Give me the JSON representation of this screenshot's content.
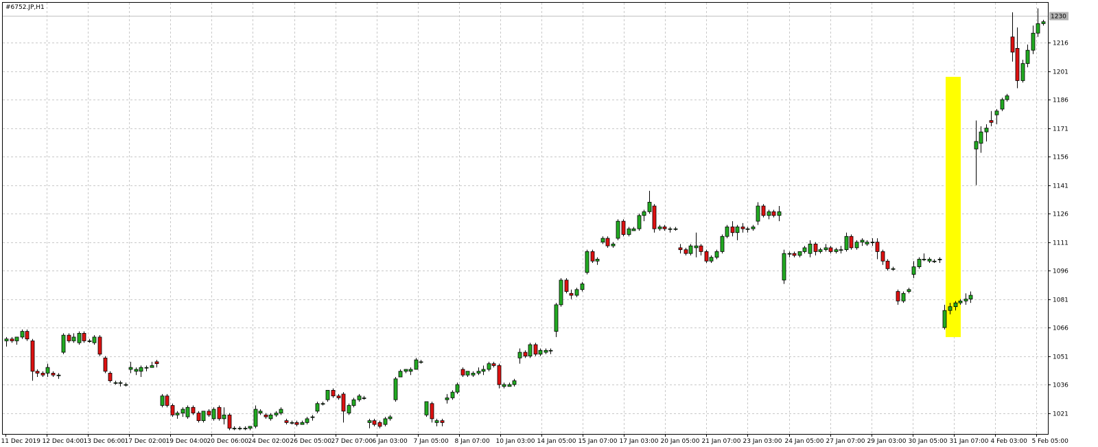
{
  "title": "#6752.JP,H1",
  "chart_data": {
    "type": "candlestick",
    "title": "#6752.JP,H1",
    "ylim": [
      1010,
      1237
    ],
    "y_ticks": [
      1216,
      1201,
      1186,
      1171,
      1156,
      1141,
      1126,
      1111,
      1096,
      1081,
      1066,
      1051,
      1036,
      1021
    ],
    "current_price": 1230,
    "x_ticks": [
      "11 Dec 2019",
      "12 Dec 04:00",
      "13 Dec 06:00",
      "17 Dec 02:00",
      "19 Dec 04:00",
      "20 Dec 06:00",
      "24 Dec 02:00",
      "26 Dec 05:00",
      "27 Dec 07:00",
      "6 Jan 03:00",
      "7 Jan 05:00",
      "8 Jan 07:00",
      "10 Jan 03:00",
      "14 Jan 05:00",
      "15 Jan 07:00",
      "17 Jan 03:00",
      "20 Jan 05:00",
      "21 Jan 07:00",
      "23 Jan 03:00",
      "24 Jan 05:00",
      "27 Jan 07:00",
      "29 Jan 03:00",
      "30 Jan 05:00",
      "31 Jan 07:00",
      "4 Feb 03:00",
      "5 Feb 05:00"
    ],
    "grid": true,
    "up_color": "#22aa22",
    "down_color": "#dd1111",
    "highlight_color": "#ffff00",
    "highlight_range": [
      1061,
      1198
    ],
    "candles": [
      [
        1059,
        1061,
        1056,
        1060
      ],
      [
        1060,
        1061,
        1058,
        1059
      ],
      [
        1059,
        1061,
        1057,
        1061
      ],
      [
        1061,
        1065,
        1060,
        1064
      ],
      [
        1064,
        1065,
        1059,
        1060
      ],
      [
        1059,
        1060,
        1038,
        1043
      ],
      [
        1043,
        1044,
        1040,
        1042
      ],
      [
        1042,
        1043,
        1040,
        1041
      ],
      [
        1042,
        1047,
        1040,
        1045
      ],
      [
        1042,
        1043,
        1040,
        1041
      ],
      [
        1041,
        1042,
        1039,
        1041
      ],
      [
        1053,
        1063,
        1052,
        1062
      ],
      [
        1062,
        1063,
        1058,
        1059
      ],
      [
        1059,
        1063,
        1058,
        1061
      ],
      [
        1058,
        1064,
        1057,
        1063
      ],
      [
        1063,
        1064,
        1058,
        1059
      ],
      [
        1059,
        1060,
        1058,
        1059
      ],
      [
        1058,
        1062,
        1057,
        1061
      ],
      [
        1061,
        1062,
        1051,
        1052
      ],
      [
        1050,
        1051,
        1042,
        1043
      ],
      [
        1042,
        1043,
        1037,
        1038
      ],
      [
        1037,
        1038,
        1036,
        1037
      ],
      [
        1037,
        1038,
        1035,
        1037
      ],
      [
        1036,
        1037,
        1035,
        1036
      ],
      [
        1044,
        1048,
        1042,
        1045
      ],
      [
        1043,
        1045,
        1041,
        1044
      ],
      [
        1043,
        1046,
        1040,
        1045
      ],
      [
        1045,
        1046,
        1043,
        1045
      ],
      [
        1045,
        1048,
        1045,
        1046
      ],
      [
        1048,
        1049,
        1045,
        1047
      ],
      [
        1025,
        1031,
        1024,
        1030
      ],
      [
        1030,
        1031,
        1024,
        1025
      ],
      [
        1025,
        1026,
        1019,
        1020
      ],
      [
        1020,
        1022,
        1018,
        1021
      ],
      [
        1021,
        1024,
        1019,
        1023
      ],
      [
        1019,
        1025,
        1018,
        1024
      ],
      [
        1024,
        1025,
        1020,
        1021
      ],
      [
        1021,
        1022,
        1016,
        1017
      ],
      [
        1017,
        1022,
        1016,
        1022
      ],
      [
        1022,
        1023,
        1019,
        1020
      ],
      [
        1018,
        1024,
        1017,
        1023
      ],
      [
        1024,
        1025,
        1017,
        1018
      ],
      [
        1018,
        1024,
        1015,
        1020
      ],
      [
        1020,
        1021,
        1012,
        1013
      ],
      [
        1013,
        1014,
        1012,
        1013
      ],
      [
        1013,
        1014,
        1012,
        1013
      ],
      [
        1013,
        1014,
        1012,
        1013
      ],
      [
        1013,
        1014,
        1012,
        1014
      ],
      [
        1014,
        1025,
        1013,
        1023
      ],
      [
        1021,
        1023,
        1020,
        1022
      ],
      [
        1020,
        1021,
        1018,
        1019
      ],
      [
        1018,
        1021,
        1017,
        1020
      ],
      [
        1020,
        1022,
        1019,
        1021
      ],
      [
        1021,
        1024,
        1020,
        1023
      ],
      [
        1017,
        1018,
        1015,
        1016
      ],
      [
        1016,
        1017,
        1015,
        1016
      ],
      [
        1016,
        1017,
        1014,
        1015
      ],
      [
        1015,
        1017,
        1015,
        1016
      ],
      [
        1016,
        1019,
        1015,
        1018
      ],
      [
        1019,
        1020,
        1017,
        1019
      ],
      [
        1022,
        1027,
        1021,
        1026
      ],
      [
        1026,
        1027,
        1025,
        1026
      ],
      [
        1028,
        1033,
        1027,
        1033
      ],
      [
        1033,
        1034,
        1029,
        1030
      ],
      [
        1030,
        1031,
        1028,
        1029
      ],
      [
        1031,
        1032,
        1016,
        1022
      ],
      [
        1021,
        1026,
        1020,
        1025
      ],
      [
        1025,
        1029,
        1024,
        1028
      ],
      [
        1028,
        1031,
        1027,
        1030
      ],
      [
        1029,
        1030,
        1028,
        1029
      ],
      [
        1016,
        1018,
        1013,
        1017
      ],
      [
        1017,
        1018,
        1014,
        1015
      ],
      [
        1016,
        1017,
        1013,
        1014
      ],
      [
        1015,
        1019,
        1014,
        1018
      ],
      [
        1018,
        1020,
        1017,
        1019
      ],
      [
        1028,
        1040,
        1027,
        1039
      ],
      [
        1040,
        1044,
        1040,
        1043
      ],
      [
        1043,
        1044,
        1042,
        1044
      ],
      [
        1043,
        1045,
        1041,
        1044
      ],
      [
        1044,
        1050,
        1044,
        1049
      ],
      [
        1048,
        1049,
        1047,
        1048
      ],
      [
        1020,
        1027,
        1019,
        1027
      ],
      [
        1026,
        1027,
        1016,
        1018
      ],
      [
        1016,
        1018,
        1014,
        1017
      ],
      [
        1017,
        1018,
        1014,
        1016
      ],
      [
        1028,
        1031,
        1026,
        1029
      ],
      [
        1029,
        1033,
        1028,
        1032
      ],
      [
        1032,
        1037,
        1031,
        1036
      ],
      [
        1044,
        1045,
        1040,
        1041
      ],
      [
        1041,
        1043,
        1040,
        1043
      ],
      [
        1041,
        1043,
        1040,
        1042
      ],
      [
        1042,
        1045,
        1041,
        1043
      ],
      [
        1043,
        1046,
        1041,
        1044
      ],
      [
        1044,
        1048,
        1043,
        1047
      ],
      [
        1047,
        1048,
        1045,
        1046
      ],
      [
        1046,
        1047,
        1034,
        1036
      ],
      [
        1035,
        1037,
        1034,
        1036
      ],
      [
        1035,
        1037,
        1035,
        1036
      ],
      [
        1036,
        1039,
        1035,
        1038
      ],
      [
        1050,
        1055,
        1047,
        1053
      ],
      [
        1053,
        1054,
        1050,
        1051
      ],
      [
        1051,
        1058,
        1050,
        1057
      ],
      [
        1057,
        1058,
        1051,
        1052
      ],
      [
        1052,
        1055,
        1051,
        1054
      ],
      [
        1053,
        1055,
        1052,
        1054
      ],
      [
        1054,
        1055,
        1052,
        1054
      ],
      [
        1064,
        1079,
        1061,
        1078
      ],
      [
        1078,
        1092,
        1077,
        1091
      ],
      [
        1091,
        1092,
        1084,
        1085
      ],
      [
        1084,
        1086,
        1081,
        1083
      ],
      [
        1083,
        1087,
        1082,
        1086
      ],
      [
        1086,
        1090,
        1085,
        1089
      ],
      [
        1095,
        1107,
        1094,
        1106
      ],
      [
        1106,
        1107,
        1100,
        1101
      ],
      [
        1101,
        1103,
        1099,
        1102
      ],
      [
        1111,
        1114,
        1110,
        1113
      ],
      [
        1113,
        1114,
        1108,
        1109
      ],
      [
        1109,
        1111,
        1108,
        1110
      ],
      [
        1113,
        1123,
        1112,
        1122
      ],
      [
        1122,
        1123,
        1114,
        1115
      ],
      [
        1115,
        1119,
        1114,
        1118
      ],
      [
        1117,
        1119,
        1117,
        1118
      ],
      [
        1118,
        1126,
        1117,
        1125
      ],
      [
        1125,
        1128,
        1122,
        1127
      ],
      [
        1127,
        1138,
        1126,
        1132
      ],
      [
        1130,
        1131,
        1116,
        1118
      ],
      [
        1118,
        1120,
        1117,
        1119
      ],
      [
        1119,
        1120,
        1117,
        1118
      ],
      [
        1118,
        1119,
        1116,
        1118
      ],
      [
        1118,
        1119,
        1117,
        1118
      ],
      [
        1108,
        1110,
        1105,
        1107
      ],
      [
        1107,
        1108,
        1104,
        1105
      ],
      [
        1105,
        1110,
        1104,
        1109
      ],
      [
        1108,
        1116,
        1103,
        1109
      ],
      [
        1109,
        1110,
        1104,
        1106
      ],
      [
        1106,
        1107,
        1100,
        1101
      ],
      [
        1101,
        1104,
        1100,
        1103
      ],
      [
        1103,
        1107,
        1102,
        1106
      ],
      [
        1106,
        1115,
        1105,
        1114
      ],
      [
        1114,
        1120,
        1113,
        1119
      ],
      [
        1119,
        1122,
        1114,
        1116
      ],
      [
        1116,
        1120,
        1112,
        1119
      ],
      [
        1119,
        1121,
        1116,
        1118
      ],
      [
        1118,
        1119,
        1116,
        1118
      ],
      [
        1118,
        1120,
        1117,
        1119
      ],
      [
        1122,
        1132,
        1120,
        1130
      ],
      [
        1130,
        1131,
        1124,
        1125
      ],
      [
        1125,
        1128,
        1123,
        1127
      ],
      [
        1127,
        1128,
        1124,
        1125
      ],
      [
        1125,
        1130,
        1122,
        1127
      ],
      [
        1091,
        1107,
        1089,
        1105
      ],
      [
        1105,
        1106,
        1103,
        1105
      ],
      [
        1105,
        1106,
        1103,
        1104
      ],
      [
        1104,
        1106,
        1103,
        1106
      ],
      [
        1106,
        1109,
        1105,
        1108
      ],
      [
        1105,
        1112,
        1103,
        1110
      ],
      [
        1110,
        1111,
        1104,
        1106
      ],
      [
        1106,
        1108,
        1105,
        1107
      ],
      [
        1107,
        1110,
        1106,
        1108
      ],
      [
        1108,
        1109,
        1105,
        1106
      ],
      [
        1106,
        1108,
        1105,
        1107
      ],
      [
        1107,
        1109,
        1105,
        1107
      ],
      [
        1107,
        1116,
        1106,
        1114
      ],
      [
        1114,
        1115,
        1107,
        1108
      ],
      [
        1108,
        1112,
        1107,
        1111
      ],
      [
        1111,
        1113,
        1109,
        1112
      ],
      [
        1110,
        1112,
        1109,
        1111
      ],
      [
        1111,
        1113,
        1109,
        1111
      ],
      [
        1111,
        1113,
        1102,
        1106
      ],
      [
        1106,
        1107,
        1099,
        1101
      ],
      [
        1101,
        1102,
        1096,
        1097
      ],
      [
        1097,
        1098,
        1096,
        1097
      ],
      [
        1085,
        1086,
        1078,
        1080
      ],
      [
        1080,
        1085,
        1079,
        1084
      ],
      [
        1085,
        1087,
        1084,
        1086
      ],
      [
        1094,
        1101,
        1092,
        1098
      ],
      [
        1098,
        1103,
        1097,
        1102
      ],
      [
        1102,
        1105,
        1101,
        1102
      ],
      [
        1101,
        1103,
        1100,
        1102
      ],
      [
        1101,
        1102,
        1100,
        1101
      ],
      [
        1102,
        1103,
        1100,
        1102
      ],
      [
        1066,
        1078,
        1065,
        1075
      ],
      [
        1075,
        1079,
        1073,
        1077
      ],
      [
        1077,
        1080,
        1075,
        1079
      ],
      [
        1079,
        1081,
        1078,
        1080
      ],
      [
        1080,
        1084,
        1078,
        1081
      ],
      [
        1081,
        1085,
        1079,
        1083
      ],
      [
        1160,
        1175,
        1141,
        1164
      ],
      [
        1163,
        1172,
        1158,
        1169
      ],
      [
        1169,
        1173,
        1164,
        1171
      ],
      [
        1175,
        1180,
        1172,
        1174
      ],
      [
        1178,
        1181,
        1173,
        1180
      ],
      [
        1181,
        1187,
        1180,
        1186
      ],
      [
        1186,
        1189,
        1185,
        1188
      ],
      [
        1219,
        1232,
        1206,
        1211
      ],
      [
        1213,
        1224,
        1192,
        1196
      ],
      [
        1196,
        1207,
        1195,
        1205
      ],
      [
        1205,
        1215,
        1203,
        1212
      ],
      [
        1212,
        1225,
        1210,
        1221
      ],
      [
        1221,
        1234,
        1219,
        1226
      ],
      [
        1226,
        1228,
        1225,
        1227
      ]
    ]
  }
}
